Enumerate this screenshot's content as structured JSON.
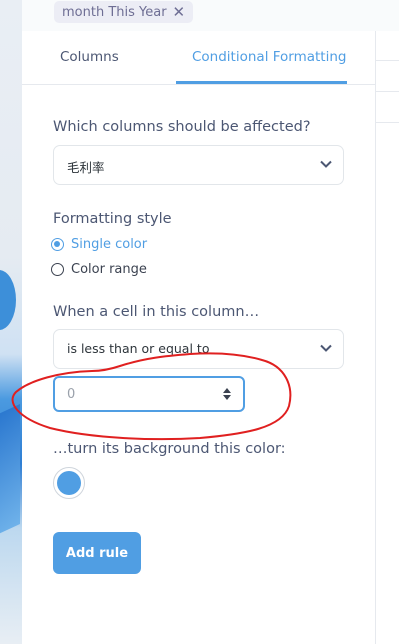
{
  "filter_chip": {
    "label": "month This Year",
    "close": "✕"
  },
  "tabs": [
    {
      "label": "Columns",
      "active": false
    },
    {
      "label": "Conditional Formatting",
      "active": true
    }
  ],
  "columns_section": {
    "heading": "Which columns should be affected?",
    "selected": "毛利率"
  },
  "formatting_style": {
    "heading": "Formatting style",
    "options": [
      {
        "label": "Single color",
        "selected": true
      },
      {
        "label": "Color range",
        "selected": false
      }
    ]
  },
  "condition": {
    "heading": "When a cell in this column…",
    "operator": "is less than or equal to",
    "value_placeholder": "0"
  },
  "background": {
    "heading": "…turn its background this color:",
    "color": "#509ee3"
  },
  "add_rule_label": "Add rule",
  "colors": {
    "accent": "#509ee3",
    "annotation": "#e02020"
  }
}
